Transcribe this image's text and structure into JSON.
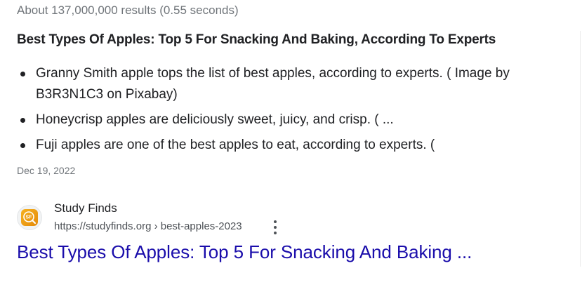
{
  "search": {
    "result_stats": "About 137,000,000 results (0.55 seconds)"
  },
  "featured_snippet": {
    "title": "Best Types Of Apples: Top 5 For Snacking And Baking, According To Experts",
    "bullets": [
      "Granny Smith apple tops the list of best apples, according to experts. ( Image by B3R3N1C3 on Pixabay)",
      "Honeycrisp apples are deliciously sweet, juicy, and crisp. ( ...",
      "Fuji apples are one of the best apples to eat, according to experts. ("
    ],
    "date": "Dec 19, 2022"
  },
  "source": {
    "site_name": "Study Finds",
    "url": "https://studyfinds.org › best-apples-2023",
    "favicon_icon": "study-finds-logo-icon",
    "favicon_text": "SF",
    "favicon_color": "#f2a516",
    "more_icon": "vertical-dots-icon",
    "link_title": "Best Types Of Apples: Top 5 For Snacking And Baking ...",
    "link_color": "#1a0dab"
  }
}
